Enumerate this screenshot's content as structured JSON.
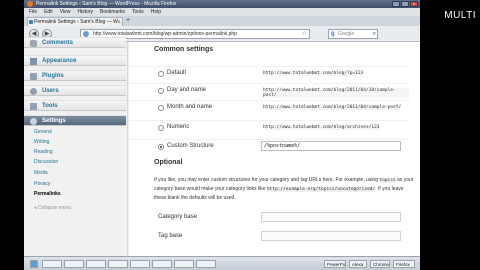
{
  "window": {
    "title": "Permalink Settings ‹ Sam's Blog — WordPress - Mozilla Firefox",
    "buttons": [
      "_",
      "□",
      "x"
    ]
  },
  "menubar": [
    "File",
    "Edit",
    "View",
    "History",
    "Bookmarks",
    "Tools",
    "Help"
  ],
  "tab": {
    "label": "Permalink Settings ‹ Sam's Blog — W...",
    "close": "x",
    "new_tab": "+"
  },
  "nav": {
    "back": "◀",
    "forward": "▶",
    "url": "http://www.totalwebmt.com/blog/wp-admin/options-permalink.php",
    "search_placeholder": "Google",
    "search_engine_letter": "g"
  },
  "sidebar": {
    "items": [
      {
        "label": "Comments",
        "icon": "comments-icon"
      },
      {
        "label": "Appearance",
        "icon": "appearance-icon"
      },
      {
        "label": "Plugins",
        "icon": "plugins-icon"
      },
      {
        "label": "Users",
        "icon": "users-icon"
      },
      {
        "label": "Tools",
        "icon": "tools-icon"
      },
      {
        "label": "Settings",
        "icon": "settings-icon",
        "active": true
      }
    ],
    "submenu": [
      "General",
      "Writing",
      "Reading",
      "Discussion",
      "Media",
      "Privacy",
      "Permalinks"
    ],
    "current_sub": "Permalinks",
    "collapse": "Collapse menu"
  },
  "common": {
    "title": "Common settings",
    "options": [
      {
        "label": "Default",
        "example": "http://www.totalwebmt.com/blog/?p=123",
        "checked": false
      },
      {
        "label": "Day and name",
        "example": "http://www.totalwebmt.com/blog/2011/04/18/sample-post/",
        "checked": false
      },
      {
        "label": "Month and name",
        "example": "http://www.totalwebmt.com/blog/2011/04/sample-post/",
        "checked": false
      },
      {
        "label": "Numeric",
        "example": "http://www.totalwebmt.com/blog/archives/123",
        "checked": false
      },
      {
        "label": "Custom Structure",
        "value": "/%postname%/",
        "checked": true
      }
    ]
  },
  "optional": {
    "title": "Optional",
    "text_1": "If you like, you may enter custom structures for your category and tag URLs here. For example, using",
    "code_1": "topics",
    "text_2": "as your category base would make your category links like",
    "code_2": "http://example.org/topics/uncategorized/",
    "text_3": ". If you leave these blank the defaults will be used.",
    "category_label": "Category base",
    "tag_label": "Tag base"
  },
  "taskbar": {
    "tasks": [
      "",
      "",
      "",
      "",
      "",
      "",
      "",
      ""
    ],
    "tray_items": [
      "PowerPoint",
      "Alexa",
      "Chrome",
      "Firefox"
    ]
  },
  "overlay_text": "MULTI"
}
